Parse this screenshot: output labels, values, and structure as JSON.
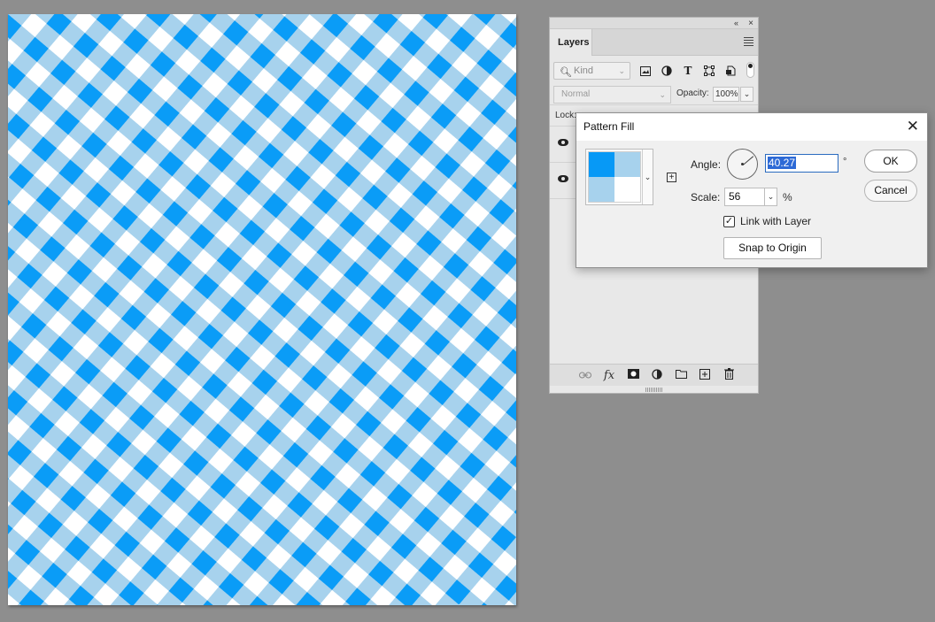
{
  "layers_panel": {
    "collapse_glyph": "«",
    "close_glyph": "×",
    "tab_label": "Layers",
    "filter": {
      "kind_placeholder": "Kind",
      "icons": [
        "image-filter-icon",
        "adjustment-filter-icon",
        "type-filter-icon",
        "shape-filter-icon",
        "smart-object-filter-icon"
      ]
    },
    "blend_mode": "Normal",
    "opacity_label": "Opacity:",
    "opacity_value": "100%",
    "lock_label": "Lock:",
    "bottom_icons": [
      "link-icon",
      "fx-icon",
      "mask-icon",
      "adjustment-icon",
      "folder-icon",
      "new-layer-icon",
      "trash-icon"
    ],
    "fx_label": "fx"
  },
  "dialog": {
    "title": "Pattern Fill",
    "close_glyph": "✕",
    "angle_label": "Angle:",
    "angle_value": "40.27",
    "degree_symbol": "°",
    "scale_label": "Scale:",
    "scale_value": "56",
    "percent_symbol": "%",
    "link_with_layer_label": "Link with Layer",
    "link_with_layer_checked": true,
    "snap_to_origin_label": "Snap to Origin",
    "ok_label": "OK",
    "cancel_label": "Cancel",
    "swatch_colors": [
      "#0799f6",
      "#a7d2ed",
      "#a7d2ed",
      "#ffffff"
    ]
  },
  "canvas": {
    "pattern_colors": [
      "#0a9cf7",
      "#a7d2ed",
      "#ffffff"
    ]
  }
}
